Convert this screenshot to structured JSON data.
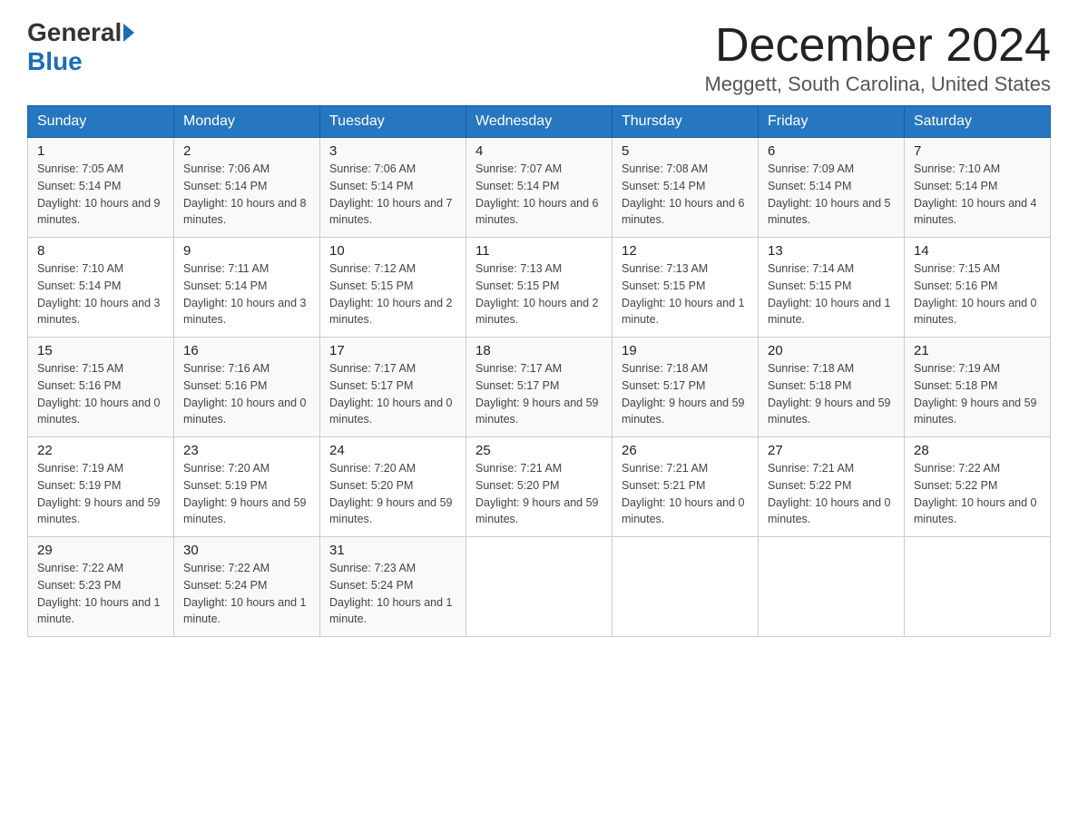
{
  "logo": {
    "general": "General",
    "blue": "Blue"
  },
  "title": "December 2024",
  "location": "Meggett, South Carolina, United States",
  "days_of_week": [
    "Sunday",
    "Monday",
    "Tuesday",
    "Wednesday",
    "Thursday",
    "Friday",
    "Saturday"
  ],
  "weeks": [
    [
      {
        "day": "1",
        "sunrise": "7:05 AM",
        "sunset": "5:14 PM",
        "daylight": "10 hours and 9 minutes."
      },
      {
        "day": "2",
        "sunrise": "7:06 AM",
        "sunset": "5:14 PM",
        "daylight": "10 hours and 8 minutes."
      },
      {
        "day": "3",
        "sunrise": "7:06 AM",
        "sunset": "5:14 PM",
        "daylight": "10 hours and 7 minutes."
      },
      {
        "day": "4",
        "sunrise": "7:07 AM",
        "sunset": "5:14 PM",
        "daylight": "10 hours and 6 minutes."
      },
      {
        "day": "5",
        "sunrise": "7:08 AM",
        "sunset": "5:14 PM",
        "daylight": "10 hours and 6 minutes."
      },
      {
        "day": "6",
        "sunrise": "7:09 AM",
        "sunset": "5:14 PM",
        "daylight": "10 hours and 5 minutes."
      },
      {
        "day": "7",
        "sunrise": "7:10 AM",
        "sunset": "5:14 PM",
        "daylight": "10 hours and 4 minutes."
      }
    ],
    [
      {
        "day": "8",
        "sunrise": "7:10 AM",
        "sunset": "5:14 PM",
        "daylight": "10 hours and 3 minutes."
      },
      {
        "day": "9",
        "sunrise": "7:11 AM",
        "sunset": "5:14 PM",
        "daylight": "10 hours and 3 minutes."
      },
      {
        "day": "10",
        "sunrise": "7:12 AM",
        "sunset": "5:15 PM",
        "daylight": "10 hours and 2 minutes."
      },
      {
        "day": "11",
        "sunrise": "7:13 AM",
        "sunset": "5:15 PM",
        "daylight": "10 hours and 2 minutes."
      },
      {
        "day": "12",
        "sunrise": "7:13 AM",
        "sunset": "5:15 PM",
        "daylight": "10 hours and 1 minute."
      },
      {
        "day": "13",
        "sunrise": "7:14 AM",
        "sunset": "5:15 PM",
        "daylight": "10 hours and 1 minute."
      },
      {
        "day": "14",
        "sunrise": "7:15 AM",
        "sunset": "5:16 PM",
        "daylight": "10 hours and 0 minutes."
      }
    ],
    [
      {
        "day": "15",
        "sunrise": "7:15 AM",
        "sunset": "5:16 PM",
        "daylight": "10 hours and 0 minutes."
      },
      {
        "day": "16",
        "sunrise": "7:16 AM",
        "sunset": "5:16 PM",
        "daylight": "10 hours and 0 minutes."
      },
      {
        "day": "17",
        "sunrise": "7:17 AM",
        "sunset": "5:17 PM",
        "daylight": "10 hours and 0 minutes."
      },
      {
        "day": "18",
        "sunrise": "7:17 AM",
        "sunset": "5:17 PM",
        "daylight": "9 hours and 59 minutes."
      },
      {
        "day": "19",
        "sunrise": "7:18 AM",
        "sunset": "5:17 PM",
        "daylight": "9 hours and 59 minutes."
      },
      {
        "day": "20",
        "sunrise": "7:18 AM",
        "sunset": "5:18 PM",
        "daylight": "9 hours and 59 minutes."
      },
      {
        "day": "21",
        "sunrise": "7:19 AM",
        "sunset": "5:18 PM",
        "daylight": "9 hours and 59 minutes."
      }
    ],
    [
      {
        "day": "22",
        "sunrise": "7:19 AM",
        "sunset": "5:19 PM",
        "daylight": "9 hours and 59 minutes."
      },
      {
        "day": "23",
        "sunrise": "7:20 AM",
        "sunset": "5:19 PM",
        "daylight": "9 hours and 59 minutes."
      },
      {
        "day": "24",
        "sunrise": "7:20 AM",
        "sunset": "5:20 PM",
        "daylight": "9 hours and 59 minutes."
      },
      {
        "day": "25",
        "sunrise": "7:21 AM",
        "sunset": "5:20 PM",
        "daylight": "9 hours and 59 minutes."
      },
      {
        "day": "26",
        "sunrise": "7:21 AM",
        "sunset": "5:21 PM",
        "daylight": "10 hours and 0 minutes."
      },
      {
        "day": "27",
        "sunrise": "7:21 AM",
        "sunset": "5:22 PM",
        "daylight": "10 hours and 0 minutes."
      },
      {
        "day": "28",
        "sunrise": "7:22 AM",
        "sunset": "5:22 PM",
        "daylight": "10 hours and 0 minutes."
      }
    ],
    [
      {
        "day": "29",
        "sunrise": "7:22 AM",
        "sunset": "5:23 PM",
        "daylight": "10 hours and 1 minute."
      },
      {
        "day": "30",
        "sunrise": "7:22 AM",
        "sunset": "5:24 PM",
        "daylight": "10 hours and 1 minute."
      },
      {
        "day": "31",
        "sunrise": "7:23 AM",
        "sunset": "5:24 PM",
        "daylight": "10 hours and 1 minute."
      },
      null,
      null,
      null,
      null
    ]
  ]
}
